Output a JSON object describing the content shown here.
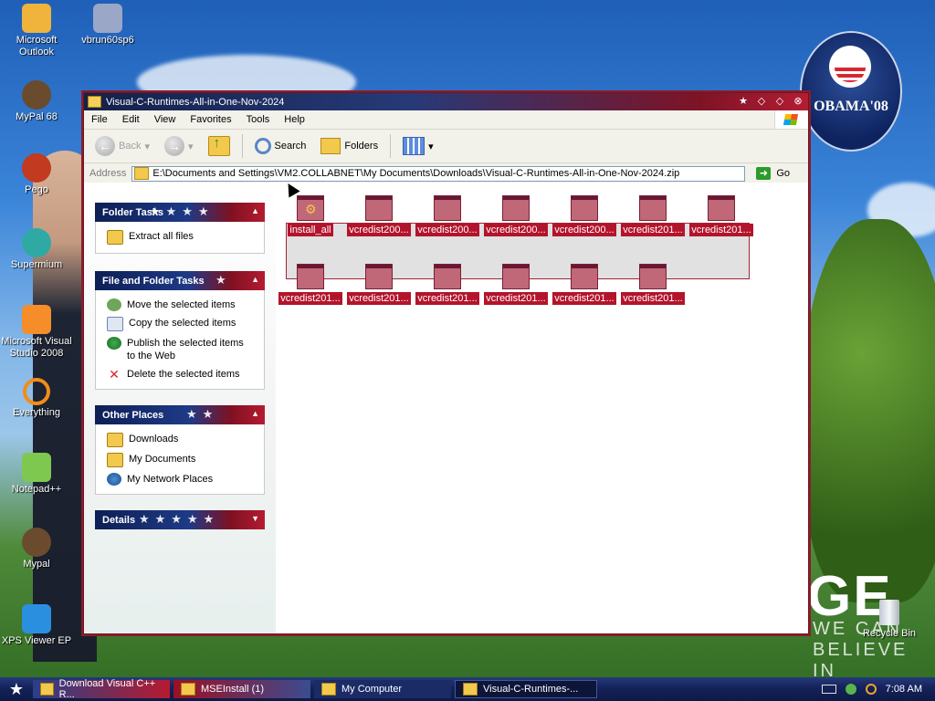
{
  "desktop": {
    "icons": [
      {
        "label": "Microsoft Outlook",
        "color": "#f0b33c"
      },
      {
        "label": "vbrun60sp6",
        "color": "#9aa7c7"
      },
      {
        "label": "MyPal 68",
        "color": "#6a4b2d"
      },
      {
        "label": "Pego",
        "color": "#c23a1f"
      },
      {
        "label": "Supermium",
        "color": "#2fa9a3"
      },
      {
        "label": "Microsoft Visual Studio 2008",
        "color": "#f58d2a"
      },
      {
        "label": "Everything",
        "color": "#f28c1a"
      },
      {
        "label": "Notepad++",
        "color": "#7ec850"
      },
      {
        "label": "Mypal",
        "color": "#6a4b2d"
      },
      {
        "label": "XPS Viewer EP",
        "color": "#2b8fe0"
      }
    ],
    "recycle_bin": "Recycle Bin",
    "seal_text": "OBAMA'08",
    "slogan_big": "GE",
    "slogan_small": "WE CAN BELIEVE IN"
  },
  "window": {
    "title": "Visual-C-Runtimes-All-in-One-Nov-2024",
    "menu": [
      "File",
      "Edit",
      "View",
      "Favorites",
      "Tools",
      "Help"
    ],
    "toolbar": {
      "back": "Back",
      "search": "Search",
      "folders": "Folders"
    },
    "address": {
      "label": "Address",
      "value": "E:\\Documents and Settings\\VM2.COLLABNET\\My Documents\\Downloads\\Visual-C-Runtimes-All-in-One-Nov-2024.zip",
      "go": "Go"
    },
    "panels": {
      "folder_tasks": {
        "title": "Folder Tasks",
        "items": [
          "Extract all files"
        ]
      },
      "file_folder_tasks": {
        "title": "File and Folder Tasks",
        "items": [
          "Move the selected items",
          "Copy the selected items",
          "Publish the selected items to the Web",
          "Delete the selected items"
        ]
      },
      "other_places": {
        "title": "Other Places",
        "items": [
          "Downloads",
          "My Documents",
          "My Network Places"
        ]
      },
      "details": {
        "title": "Details"
      }
    },
    "files": [
      "install_all",
      "vcredist200...",
      "vcredist200...",
      "vcredist200...",
      "vcredist200...",
      "vcredist201...",
      "vcredist201...",
      "vcredist201...",
      "vcredist201...",
      "vcredist201...",
      "vcredist201...",
      "vcredist201...",
      "vcredist201..."
    ]
  },
  "taskbar": {
    "tasks": [
      "Download Visual C++ R...",
      "MSEInstall (1)",
      "My Computer",
      "Visual-C-Runtimes-..."
    ],
    "clock": "7:08 AM"
  }
}
